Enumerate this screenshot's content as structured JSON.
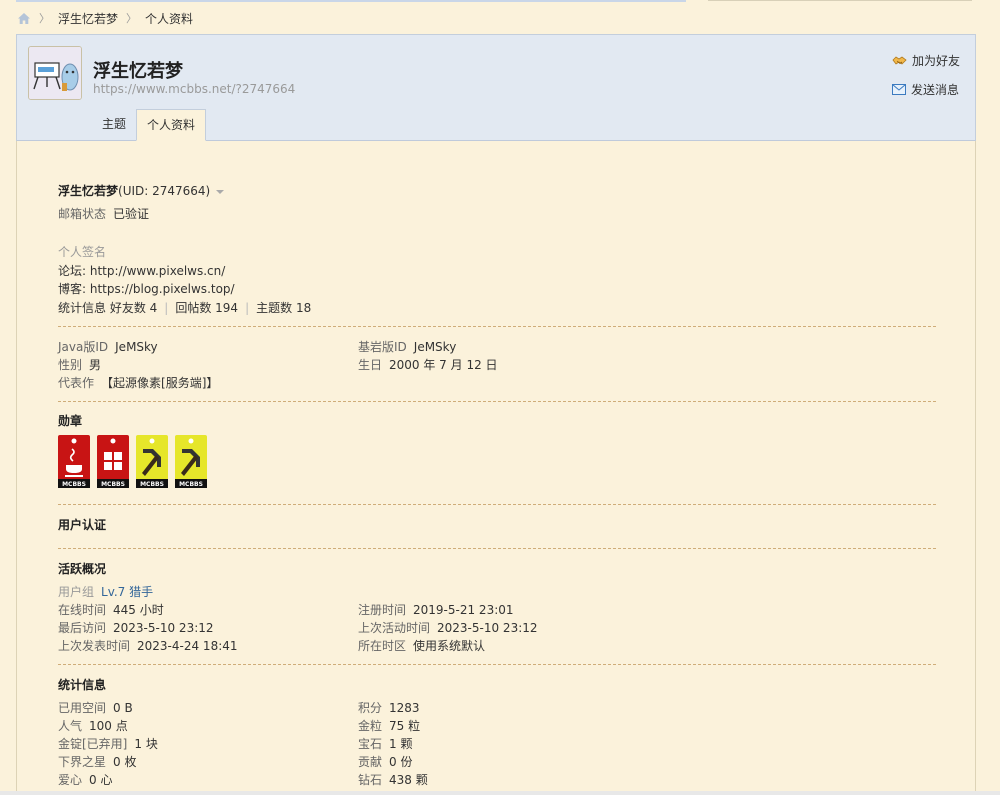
{
  "breadcrumb": {
    "items": [
      "浮生忆若梦",
      "个人资料"
    ]
  },
  "header": {
    "username": "浮生忆若梦",
    "url": "https://www.mcbbs.net/?2747664",
    "add_friend": "加为好友",
    "send_message": "发送消息",
    "tabs": [
      {
        "label": "主题"
      },
      {
        "label": "个人资料"
      }
    ]
  },
  "profile": {
    "name_line": "浮生忆若梦",
    "uid": "(UID: 2747664)",
    "email_label": "邮箱状态",
    "email_value": "已验证",
    "signature_label": "个人签名",
    "signature_line1": "论坛: http://www.pixelws.cn/",
    "signature_line2": "博客: https://blog.pixelws.top/",
    "stats_label": "统计信息",
    "friends": "好友数 4",
    "replies": "回帖数 194",
    "threads": "主题数 18"
  },
  "details": {
    "java_label": "Java版ID",
    "java_value": "JeMSky",
    "bedrock_label": "基岩版ID",
    "bedrock_value": "JeMSky",
    "gender_label": "性别",
    "gender_value": "男",
    "birthday_label": "生日",
    "birthday_value": "2000 年 7 月 12 日",
    "work_label": "代表作",
    "work_value": "【起源像素[服务端]】"
  },
  "medals": {
    "title": "勋章",
    "badge_text": "MCBBS",
    "colors": [
      "#cc1111",
      "#cc1111",
      "#e8e82a",
      "#e8e82a"
    ]
  },
  "certification": {
    "title": "用户认证"
  },
  "activity": {
    "title": "活跃概况",
    "group_label": "用户组",
    "group_value": "Lv.7 猎手",
    "online_label": "在线时间",
    "online_value": "445 小时",
    "register_label": "注册时间",
    "register_value": "2019-5-21 23:01",
    "last_visit_label": "最后访问",
    "last_visit_value": "2023-5-10 23:12",
    "last_active_label": "上次活动时间",
    "last_active_value": "2023-5-10 23:12",
    "last_post_label": "上次发表时间",
    "last_post_value": "2023-4-24 18:41",
    "timezone_label": "所在时区",
    "timezone_value": "使用系统默认"
  },
  "stats": {
    "title": "统计信息",
    "space_label": "已用空间",
    "space_value": "0 B",
    "points_label": "积分",
    "points_value": "1283",
    "popularity_label": "人气",
    "popularity_value": "100 点",
    "gold_label": "金粒",
    "gold_value": "75 粒",
    "ingot_label": "金锭[已弃用]",
    "ingot_value": "1 块",
    "gem_label": "宝石",
    "gem_value": "1 颗",
    "nether_label": "下界之星",
    "nether_value": "0 枚",
    "contrib_label": "贡献",
    "contrib_value": "0 份",
    "love_label": "爱心",
    "love_value": "0 心",
    "diamond_label": "钻石",
    "diamond_value": "438 颗"
  }
}
